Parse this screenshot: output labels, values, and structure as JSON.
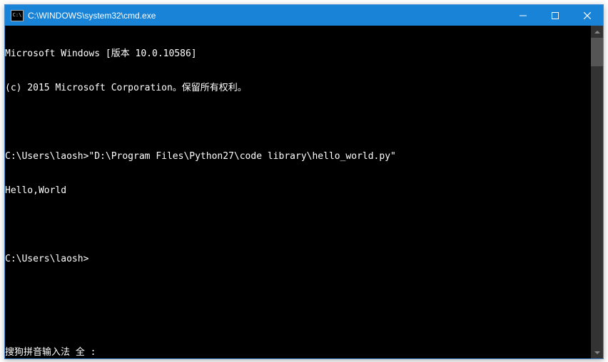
{
  "titlebar": {
    "icon_glyph": "C:\\",
    "title": "C:\\WINDOWS\\system32\\cmd.exe"
  },
  "terminal": {
    "lines": [
      "Microsoft Windows [版本 10.0.10586]",
      "(c) 2015 Microsoft Corporation。保留所有权利。",
      "",
      "C:\\Users\\laosh>\"D:\\Program Files\\Python27\\code library\\hello_world.py\"",
      "Hello,World",
      "",
      "C:\\Users\\laosh>"
    ],
    "ime_status": "搜狗拼音输入法 全 :"
  }
}
